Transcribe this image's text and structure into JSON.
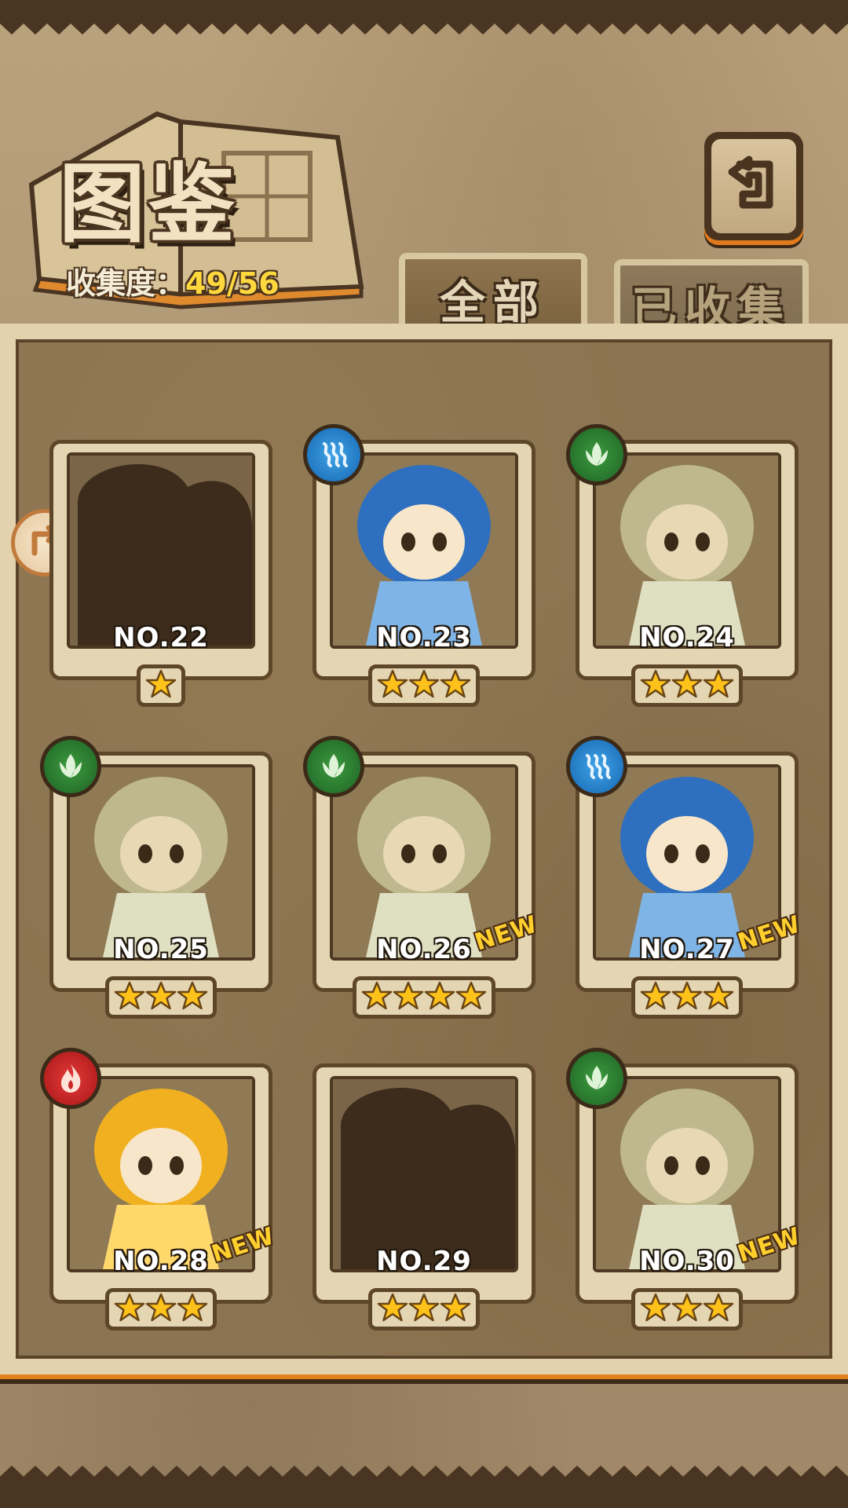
{
  "header": {
    "title": "图鉴",
    "collect_label": "收集度：",
    "collect_value": "49/56"
  },
  "tabs": [
    {
      "label": "全部",
      "active": true
    },
    {
      "label": "已收集",
      "active": false
    }
  ],
  "cards": [
    {
      "number": "NO.22",
      "element": null,
      "stars": 1,
      "new": false,
      "silhouette": true
    },
    {
      "number": "NO.23",
      "element": "water",
      "stars": 3,
      "new": false,
      "silhouette": false
    },
    {
      "number": "NO.24",
      "element": "leaf",
      "stars": 3,
      "new": false,
      "silhouette": false
    },
    {
      "number": "NO.25",
      "element": "leaf",
      "stars": 3,
      "new": false,
      "silhouette": false
    },
    {
      "number": "NO.26",
      "element": "leaf",
      "stars": 4,
      "new": true,
      "silhouette": false
    },
    {
      "number": "NO.27",
      "element": "water",
      "stars": 3,
      "new": true,
      "silhouette": false
    },
    {
      "number": "NO.28",
      "element": "fire",
      "stars": 3,
      "new": true,
      "silhouette": false
    },
    {
      "number": "NO.29",
      "element": null,
      "stars": 3,
      "new": false,
      "silhouette": true
    },
    {
      "number": "NO.30",
      "element": "leaf",
      "stars": 3,
      "new": true,
      "silhouette": false
    }
  ],
  "new_badge": "NEW",
  "colors": {
    "water": "#1f7fd0",
    "leaf": "#2e7d32",
    "fire": "#c62828",
    "star": "#ffc21a",
    "accent_orange": "#e27f1e"
  }
}
